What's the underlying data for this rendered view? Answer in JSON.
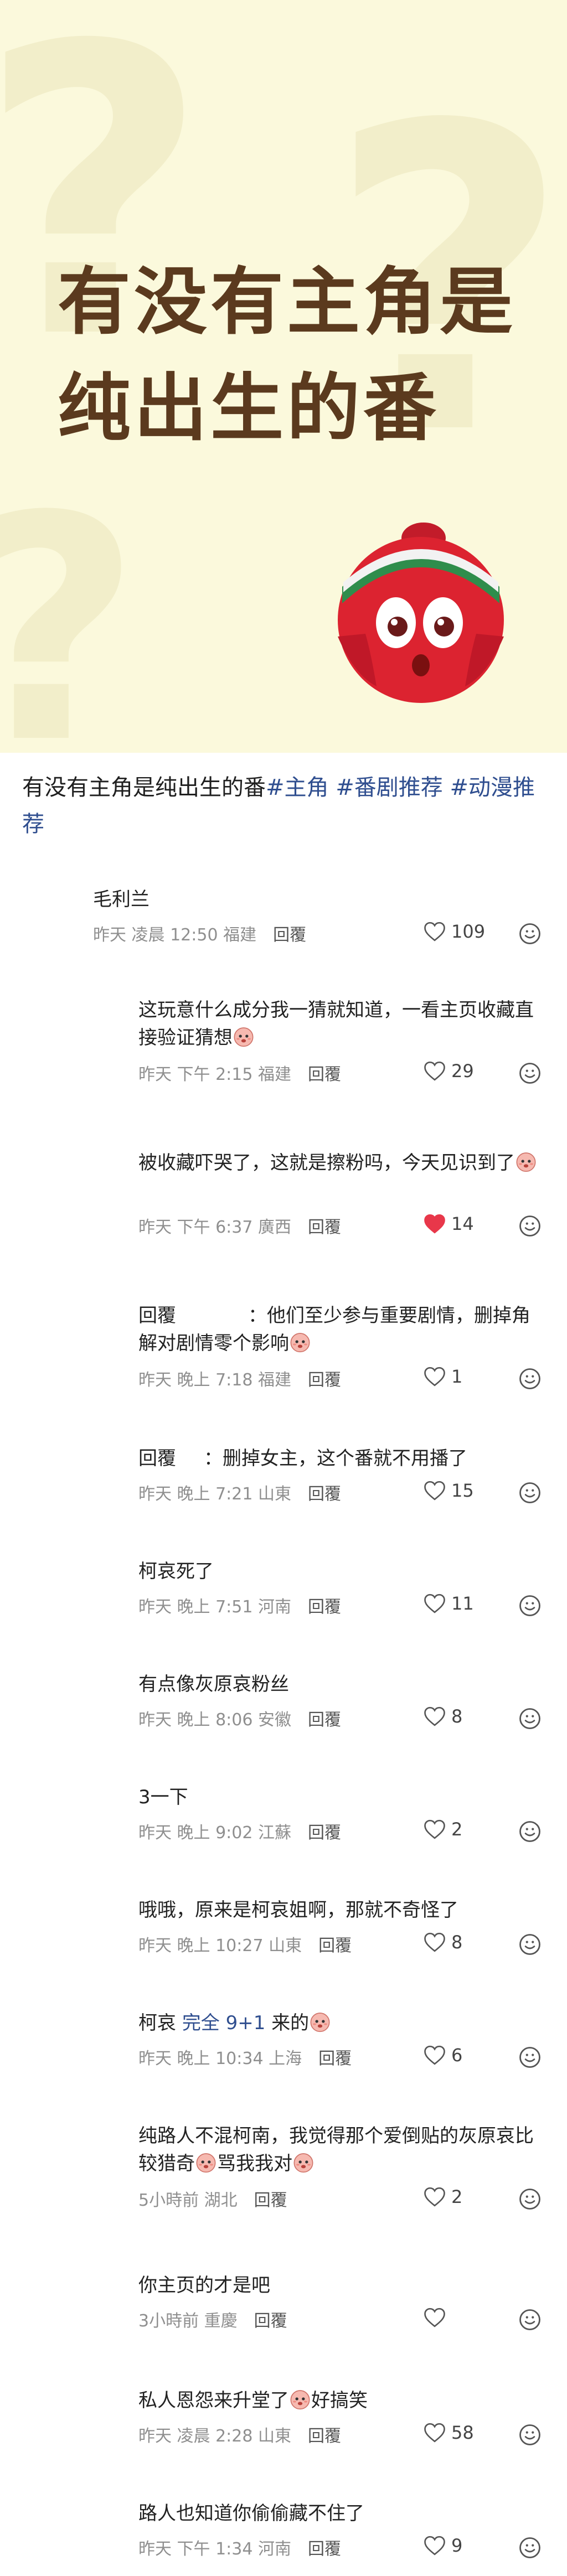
{
  "banner": {
    "title_line1": "有没有主角是",
    "title_line2": "纯出生的番"
  },
  "caption": {
    "text": "有没有主角是纯出生的番",
    "tags": [
      "#主角",
      "#番剧推荐",
      "#动漫推荐"
    ]
  },
  "icons": {
    "like": "heart-icon",
    "emoji": "smile-icon",
    "liked_color": "#e8374a"
  },
  "reply_label": "回覆",
  "comments": [
    {
      "user": "毛利兰",
      "text": "",
      "time": "昨天 凌晨 12:50",
      "location": "福建",
      "likes": "109",
      "liked": false
    },
    {
      "user": "",
      "text": "这玩意什么成分我一猜就知道，一看主页收藏直接验证猜想",
      "time": "昨天 下午 2:15",
      "location": "福建",
      "likes": "29",
      "liked": false
    },
    {
      "user": "",
      "text": "被收藏吓哭了，这就是擦粉吗，今天见识到了",
      "time": "昨天 下午 6:37",
      "location": "廣西",
      "likes": "14",
      "liked": true
    },
    {
      "user": "",
      "prefix": "回覆",
      "text": "：他们至少参与重要剧情，删掉角解对剧情零个影响",
      "time": "昨天 晚上 7:18",
      "location": "福建",
      "likes": "1",
      "liked": false
    },
    {
      "user": "",
      "prefix": "回覆",
      "text": "：删掉女主，这个番就不用播了",
      "time": "昨天 晚上 7:21",
      "location": "山東",
      "likes": "15",
      "liked": false
    },
    {
      "user": "",
      "text": "柯哀死了",
      "time": "昨天 晚上 7:51",
      "location": "河南",
      "likes": "11",
      "liked": false
    },
    {
      "user": "",
      "text": "有点像灰原哀粉丝",
      "time": "昨天 晚上 8:06",
      "location": "安徽",
      "likes": "8",
      "liked": false
    },
    {
      "user": "",
      "text": "3一下",
      "time": "昨天 晚上 9:02",
      "location": "江蘇",
      "likes": "2",
      "liked": false
    },
    {
      "user": "",
      "text": "哦哦，原来是柯哀姐啊，那就不奇怪了",
      "time": "昨天 晚上 10:27",
      "location": "山東",
      "likes": "8",
      "liked": false
    },
    {
      "user": "",
      "text_a": "柯哀",
      "text_hl": "完全 9+1",
      "text_b": "来的",
      "time": "昨天 晚上 10:34",
      "location": "上海",
      "likes": "6",
      "liked": false
    },
    {
      "user": "",
      "text_a": "纯路人不混柯南，我觉得那个爱倒贴的灰原哀比较猎奇",
      "text_b": "骂我我对",
      "time": "5小時前",
      "location": "湖北",
      "likes": "2",
      "liked": false
    },
    {
      "user": "",
      "text": "你主页的才是吧",
      "time": "3小時前",
      "location": "重慶",
      "likes": "",
      "liked": false
    },
    {
      "user": "",
      "text_a": "私人恩怨来升堂了",
      "text_b": "好搞笑",
      "time": "昨天 凌晨 2:28",
      "location": "山東",
      "likes": "58",
      "liked": false
    },
    {
      "user": "",
      "text": "路人也知道你偷偷藏不住了",
      "time": "昨天 下午 1:34",
      "location": "河南",
      "likes": "9",
      "liked": false
    }
  ]
}
